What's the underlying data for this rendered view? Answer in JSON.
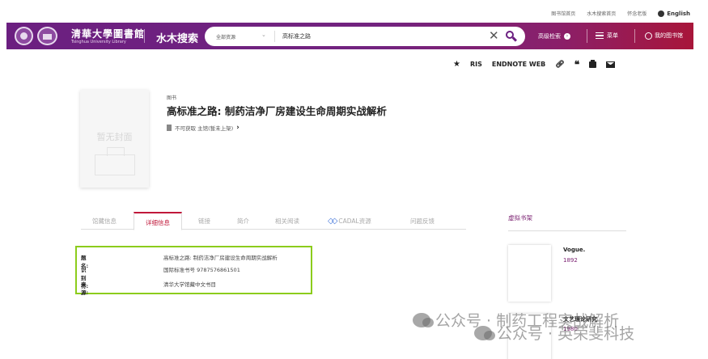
{
  "util_links": [
    "图书馆首页",
    "水木搜索首页",
    "怀念老版"
  ],
  "lang": "English",
  "header": {
    "logo_cn": "清華大學圖書館",
    "logo_en": "Tsinghua University Library",
    "brand": "水木搜索",
    "scope": "全部资源",
    "query": "高标准之路",
    "advanced": "高级检索",
    "menu": "菜单",
    "my_library": "我的图书馆"
  },
  "export": {
    "ris": "RIS",
    "endnote": "ENDNOTE WEB"
  },
  "record": {
    "cover_text": "暂无封面",
    "type": "图书",
    "title": "高标准之路: 制药洁净厂房建设生命周期实战解析",
    "holding": "不可获取  主馆(暂未上架)"
  },
  "tabs": [
    "馆藏信息",
    "详细信息",
    "链接",
    "简介",
    "相关阅读",
    "CADAL资源",
    "问题反馈"
  ],
  "details": [
    {
      "label": "题名:",
      "value": "高标准之路: 制药洁净厂房建设生命周期实战解析"
    },
    {
      "label": "识别符:",
      "value": "国际标准书号 9787576861501"
    },
    {
      "label": "来源:",
      "value": "清华大学馆藏中文书目"
    }
  ],
  "shelf": {
    "title": "虚拟书架",
    "items": [
      {
        "title": "Vogue.",
        "year": "1892"
      },
      {
        "title": "文艺理论研究",
        "year": "1980"
      }
    ]
  },
  "watermarks": [
    "公众号 · 制药工程实战解析",
    "公众号 · 英荣斐科技"
  ],
  "colors": {
    "header_purple": "#6b1f80",
    "header_red": "#a8163a",
    "tab_active": "#c0183a",
    "highlight_green": "#8ccc1c"
  }
}
